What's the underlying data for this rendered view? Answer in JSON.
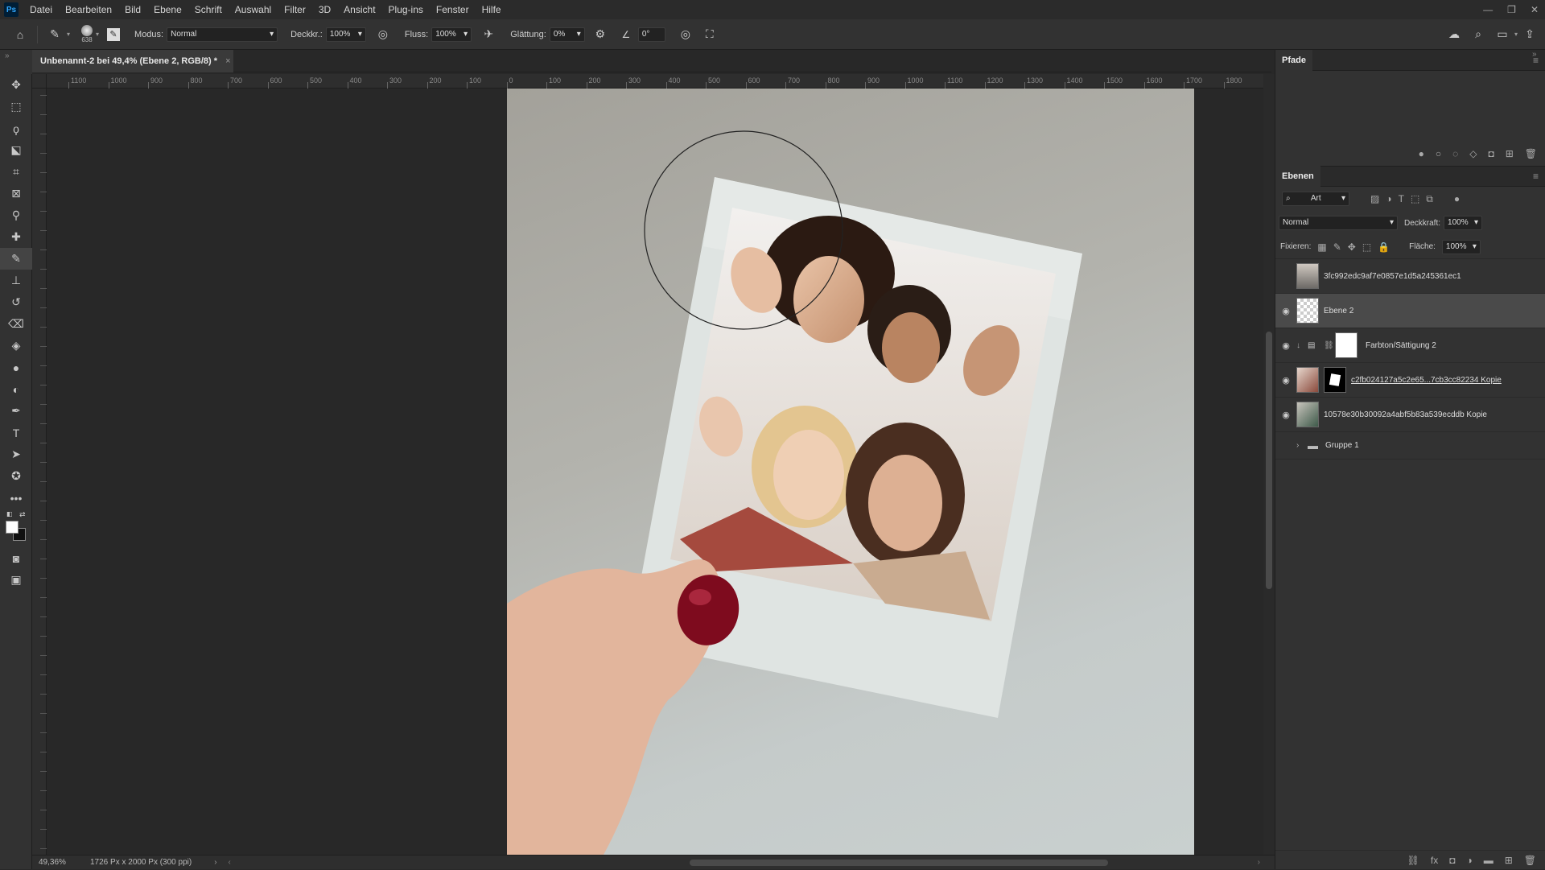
{
  "menu": {
    "logo": "Ps",
    "items": [
      "Datei",
      "Bearbeiten",
      "Bild",
      "Ebene",
      "Schrift",
      "Auswahl",
      "Filter",
      "3D",
      "Ansicht",
      "Plug-ins",
      "Fenster",
      "Hilfe"
    ]
  },
  "options": {
    "brush_size": "638",
    "mode_label": "Modus:",
    "mode_value": "Normal",
    "opacity_label": "Deckkr.:",
    "opacity_value": "100%",
    "flow_label": "Fluss:",
    "flow_value": "100%",
    "smoothing_label": "Glättung:",
    "smoothing_value": "0%",
    "angle_value": "0°"
  },
  "document": {
    "tab_title": "Unbenannt-2 bei 49,4% (Ebene 2, RGB/8) *"
  },
  "ruler_top_labels": [
    "1100",
    "1000",
    "900",
    "800",
    "700",
    "600",
    "500",
    "400",
    "300",
    "200",
    "100",
    "0",
    "100",
    "200",
    "300",
    "400",
    "500",
    "600",
    "700",
    "800",
    "900",
    "1000",
    "1100",
    "1200",
    "1300",
    "1400",
    "1500",
    "1600",
    "1700",
    "1800"
  ],
  "status": {
    "zoom": "49,36%",
    "doc_size": "1726 Px x 2000 Px (300 ppi)"
  },
  "paths_panel": {
    "title": "Pfade"
  },
  "layers_panel": {
    "title": "Ebenen",
    "filter_kind": "Art",
    "blend_mode": "Normal",
    "opacity_label": "Deckkraft:",
    "opacity_value": "100%",
    "lock_label": "Fixieren:",
    "fill_label": "Fläche:",
    "fill_value": "100%",
    "layers": [
      {
        "name": "3fc992edc9af7e0857e1d5a245361ec1",
        "visible": false
      },
      {
        "name": "Ebene 2",
        "visible": true
      },
      {
        "name": "Farbton/Sättigung 2",
        "visible": true
      },
      {
        "name": "c2fb024127a5c2e65...7cb3cc82234  Kopie",
        "visible": true
      },
      {
        "name": "10578e30b30092a4abf5b83a539ecddb  Kopie",
        "visible": true
      },
      {
        "name": "Gruppe 1",
        "visible": false
      }
    ]
  },
  "colors": {
    "accent": "#31a8ff",
    "panel": "#323232",
    "canvas_bg": "#282828"
  }
}
